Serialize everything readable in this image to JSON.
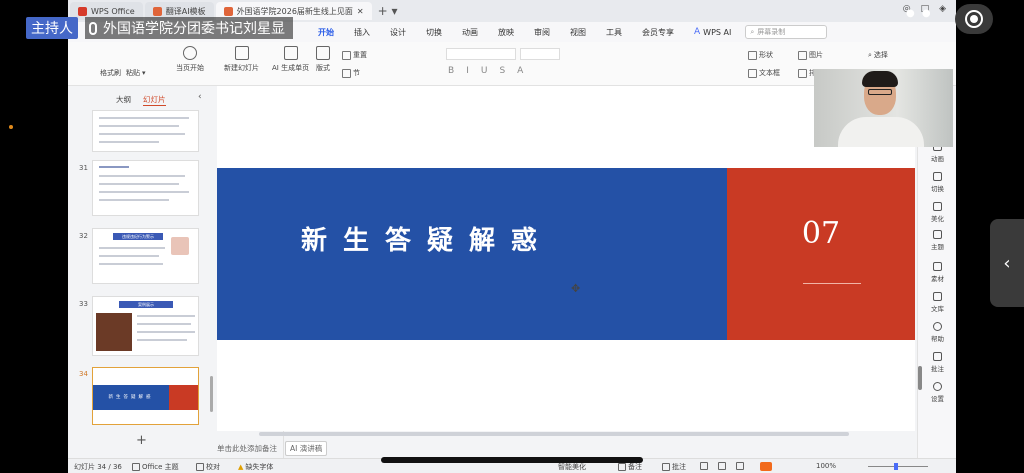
{
  "overlay": {
    "host_badge": "主持人",
    "host_name": "外国语学院分团委书记刘星显"
  },
  "tabs": [
    {
      "label": "WPS Office",
      "color": "#d63a2a"
    },
    {
      "label": "翻译AI模板",
      "color": "#e0653a"
    },
    {
      "label": "外国语学院2026届新生线上见面",
      "color": "#e0653a"
    }
  ],
  "menu": {
    "items": [
      "开始",
      "插入",
      "设计",
      "切换",
      "动画",
      "放映",
      "审阅",
      "视图",
      "工具",
      "会员专享"
    ],
    "active": "开始",
    "wps_ai": "WPS AI",
    "search_placeholder": "屏幕录制"
  },
  "ribbon": {
    "format_painter": "格式刷",
    "paste": "粘贴",
    "from_current": "当页开始",
    "new_slide": "新建幻灯片",
    "ai_single": "AI 生成单页",
    "layout": "版式",
    "reset": "重置",
    "section": "节",
    "shape": "形状",
    "picture": "图片",
    "textbox": "文本框",
    "arrange": "排列",
    "select": "选择"
  },
  "left_panel": {
    "tab_outline": "大纲",
    "tab_slides": "幻灯片",
    "thumbs": [
      {
        "num": "",
        "title": ""
      },
      {
        "num": "31",
        "title": ""
      },
      {
        "num": "32",
        "title": "违规违纪行为警示"
      },
      {
        "num": "33",
        "title": "案例展示"
      },
      {
        "num": "34",
        "title": "新生答疑解惑"
      }
    ],
    "add_label": "+"
  },
  "slide": {
    "title": "新生答疑解惑",
    "number": "07",
    "blue": "#2451a6",
    "red": "#c93a24"
  },
  "notes": {
    "placeholder": "单击此处添加备注",
    "ai_speech": "AI 演讲稿"
  },
  "right_bar": [
    "动画",
    "切换",
    "美化",
    "主题",
    "素材",
    "文库",
    "帮助",
    "批注",
    "设置"
  ],
  "status": {
    "slide_counter": "幻灯片 34 / 36",
    "theme": "Office 主题",
    "proofread": "校对",
    "missing_font": "缺失字体",
    "smart_beautify": "智能美化",
    "notes": "备注",
    "comments": "批注",
    "zoom": "100%"
  }
}
